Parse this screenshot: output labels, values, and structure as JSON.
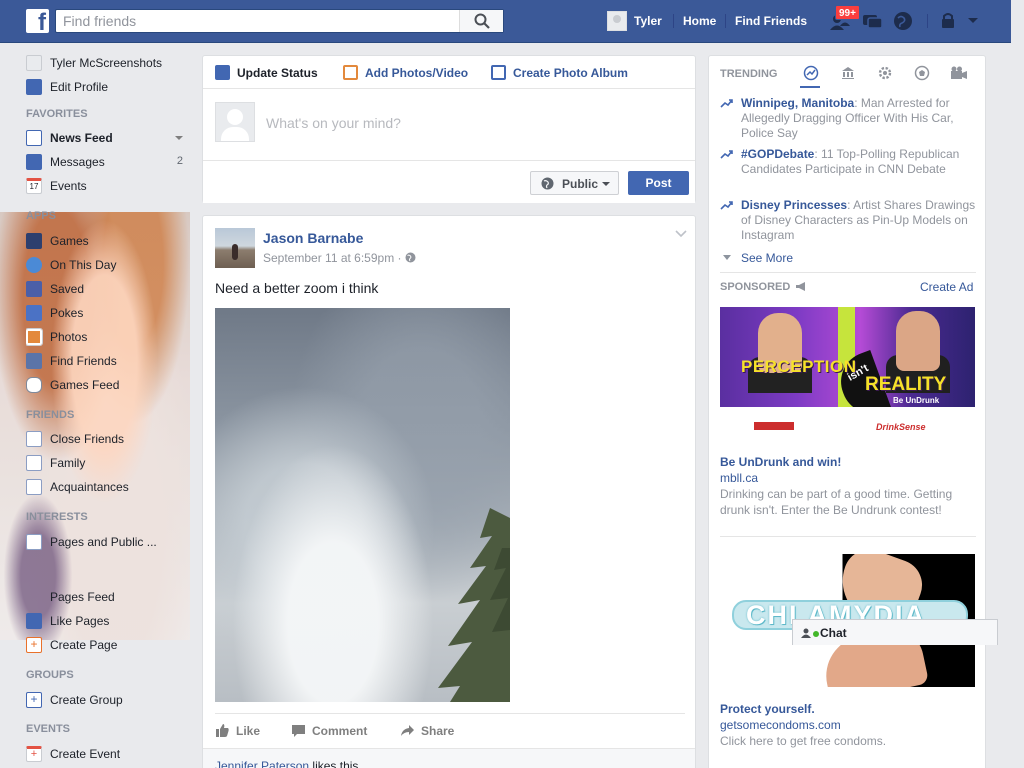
{
  "colors": {
    "brand": "#3b5998",
    "link": "#365899",
    "button": "#4267b2",
    "badge": "#fa3e3e"
  },
  "topbar": {
    "search_placeholder": "Find friends",
    "user_name": "Tyler",
    "home": "Home",
    "find_friends": "Find Friends",
    "friend_requests_count": "99+"
  },
  "sidebar": {
    "profile_name": "Tyler McScreenshots",
    "edit_profile": "Edit Profile",
    "sections": {
      "favorites": "FAVORITES",
      "apps": "APPS",
      "friends": "FRIENDS",
      "interests": "INTERESTS",
      "groups": "GROUPS",
      "events": "EVENTS"
    },
    "favorites": [
      {
        "label": "News Feed",
        "icon": "news-feed-icon"
      },
      {
        "label": "Messages",
        "icon": "messages-icon",
        "count": "2"
      },
      {
        "label": "Events",
        "icon": "calendar-icon",
        "date": "17"
      }
    ],
    "apps": [
      {
        "label": "Games",
        "icon": "games-icon"
      },
      {
        "label": "On This Day",
        "icon": "clock-icon"
      },
      {
        "label": "Saved",
        "icon": "bookmark-icon"
      },
      {
        "label": "Pokes",
        "icon": "poke-icon"
      },
      {
        "label": "Photos",
        "icon": "photos-icon"
      },
      {
        "label": "Find Friends",
        "icon": "find-friends-icon"
      },
      {
        "label": "Games Feed",
        "icon": "gamepad-icon"
      }
    ],
    "friends": [
      {
        "label": "Close Friends",
        "icon": "star-list-icon"
      },
      {
        "label": "Family",
        "icon": "family-list-icon"
      },
      {
        "label": "Acquaintances",
        "icon": "acquaintances-icon"
      }
    ],
    "interests": [
      {
        "label": "Pages and Public ...",
        "icon": "list-icon"
      },
      {
        "label": "Pages Feed",
        "icon": "pages-feed-icon"
      },
      {
        "label": "Like Pages",
        "icon": "like-pages-icon"
      },
      {
        "label": "Create Page",
        "icon": "create-page-icon"
      }
    ],
    "groups": [
      {
        "label": "Create Group",
        "icon": "create-group-icon"
      }
    ],
    "events": [
      {
        "label": "Create Event",
        "icon": "create-event-icon"
      }
    ]
  },
  "composer": {
    "tabs": [
      {
        "label": "Update Status",
        "icon": "pencil-icon"
      },
      {
        "label": "Add Photos/Video",
        "icon": "photo-icon"
      },
      {
        "label": "Create Photo Album",
        "icon": "album-icon"
      }
    ],
    "placeholder": "What's on your mind?",
    "privacy": "Public",
    "post_button": "Post"
  },
  "post": {
    "author": "Jason Barnabe",
    "timestamp": "September 11 at 6:59pm ·",
    "text": "Need a better zoom i think",
    "actions": {
      "like": "Like",
      "comment": "Comment",
      "share": "Share"
    },
    "likes_name": "Jennifer Paterson",
    "likes_suffix": " likes this."
  },
  "trending": {
    "title": "TRENDING",
    "categories": [
      "trending-icon",
      "politics-icon",
      "science-icon",
      "sports-icon",
      "entertainment-icon"
    ],
    "items": [
      {
        "topic": "Winnipeg, Manitoba",
        "sep": ": ",
        "desc": "Man Arrested for Allegedly Dragging Officer With His Car, Police Say"
      },
      {
        "topic": "#GOPDebate",
        "sep": ": ",
        "desc": "11 Top-Polling Republican Candidates Participate in CNN Debate"
      },
      {
        "topic": "Disney Princesses",
        "sep": ": ",
        "desc": "Artist Shares Drawings of Disney Characters as Pin-Up Models on Instagram"
      }
    ],
    "see_more": "See More"
  },
  "sponsored": {
    "title": "SPONSORED",
    "create_ad": "Create Ad",
    "ads": [
      {
        "image_words": [
          "PERCEPTION",
          "isn't",
          "REALITY",
          "Be UnDrunk",
          "DrinkSense"
        ],
        "title": "Be UnDrunk and win!",
        "url": "mbll.ca",
        "desc": "Drinking can be part of a good time. Getting drunk isn't. Enter the Be Undrunk contest!"
      },
      {
        "image_words": [
          "CHLAMYDIA"
        ],
        "title": "Protect yourself.",
        "url": "getsomecondoms.com",
        "desc": "Click here to get free condoms."
      }
    ]
  },
  "chat": {
    "label": "Chat"
  }
}
